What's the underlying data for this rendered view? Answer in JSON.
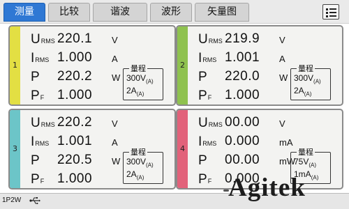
{
  "tabs": [
    {
      "label": "测量"
    },
    {
      "label": "比较"
    },
    {
      "label": "谐波"
    },
    {
      "label": "波形"
    },
    {
      "label": "矢量图"
    }
  ],
  "active_tab": "测量",
  "menu_icon": "list-menu-icon",
  "symbols": {
    "u": "U",
    "u_sub": "RMS",
    "i": "I",
    "i_sub": "RMS",
    "p": "P",
    "pf": "P",
    "pf_sub": "F"
  },
  "range_title": "量程",
  "channels": [
    {
      "number": "1",
      "color": "#e3df43",
      "u": "220.1",
      "u_unit": "V",
      "i": "1.000",
      "i_unit": "A",
      "p": "220.2",
      "p_unit": "W",
      "pf": "1.000",
      "range_v": "300V",
      "range_v_sub": "(A)",
      "range_a": "2A",
      "range_a_sub": "(A)"
    },
    {
      "number": "2",
      "color": "#8fc24f",
      "u": "219.9",
      "u_unit": "V",
      "i": "1.001",
      "i_unit": "A",
      "p": "220.0",
      "p_unit": "W",
      "pf": "1.000",
      "range_v": "300V",
      "range_v_sub": "(A)",
      "range_a": "2A",
      "range_a_sub": "(A)"
    },
    {
      "number": "3",
      "color": "#6cc5c8",
      "u": "220.2",
      "u_unit": "V",
      "i": "1.001",
      "i_unit": "A",
      "p": "220.5",
      "p_unit": "W",
      "pf": "1.000",
      "range_v": "300V",
      "range_v_sub": "(A)",
      "range_a": "2A",
      "range_a_sub": "(A)"
    },
    {
      "number": "4",
      "color": "#e2627a",
      "u": "00.00",
      "u_unit": "V",
      "i": "0.000",
      "i_unit": "mA",
      "p": "00.00",
      "p_unit": "mW",
      "pf": "0.000",
      "range_v": "75V",
      "range_v_sub": "(A)",
      "range_a": "1mA",
      "range_a_sub": "(A)"
    }
  ],
  "status": {
    "mode": "1P2W",
    "usb_icon": "usb-icon"
  },
  "watermark": "Agitek",
  "colors": {
    "active_tab": "#2f78d4",
    "panel_bg": "#f3f3f1"
  }
}
